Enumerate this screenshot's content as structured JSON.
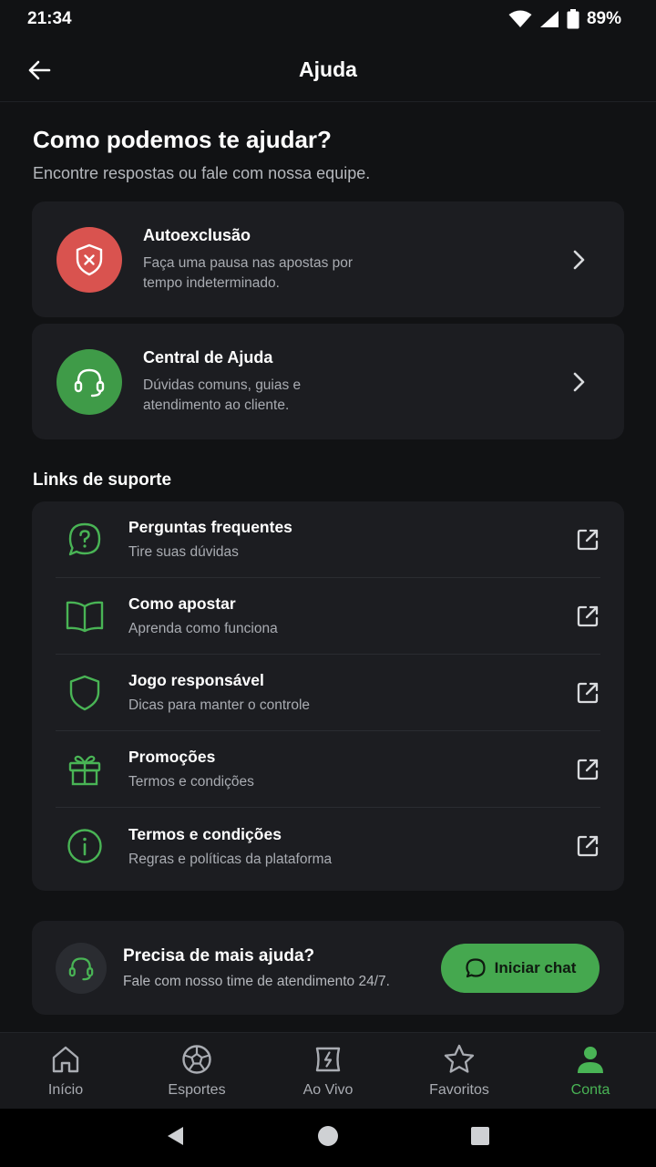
{
  "status": {
    "time": "21:34",
    "battery": "89%"
  },
  "header": {
    "title": "Ajuda"
  },
  "intro": {
    "title": "Como podemos te ajudar?",
    "subtitle": "Encontre respostas ou fale com nossa equipe."
  },
  "actions": [
    {
      "title": "Autoexclusão",
      "desc": "Faça uma pausa nas apostas por tempo indeterminado.",
      "icon": "shield-x-icon",
      "color": "#d9534f"
    },
    {
      "title": "Central de Ajuda",
      "desc": "Dúvidas comuns, guias e atendimento ao cliente.",
      "icon": "headset-icon",
      "color": "#3f9b48"
    }
  ],
  "support": {
    "title": "Links de suporte",
    "links": [
      {
        "title": "Perguntas frequentes",
        "desc": "Tire suas dúvidas",
        "icon": "question-bubble-icon"
      },
      {
        "title": "Como apostar",
        "desc": "Aprenda como funciona",
        "icon": "book-icon"
      },
      {
        "title": "Jogo responsável",
        "desc": "Dicas para manter o controle",
        "icon": "shield-icon"
      },
      {
        "title": "Promoções",
        "desc": "Termos e condições",
        "icon": "gift-icon"
      },
      {
        "title": "Termos e condições",
        "desc": "Regras e políticas da plataforma",
        "icon": "info-icon"
      }
    ]
  },
  "help": {
    "title": "Precisa de mais ajuda?",
    "desc": "Fale com nosso time de atendimento 24/7.",
    "button": "Iniciar chat"
  },
  "nav": {
    "items": [
      {
        "label": "Início",
        "icon": "home-icon"
      },
      {
        "label": "Esportes",
        "icon": "soccer-ball-icon"
      },
      {
        "label": "Ao Vivo",
        "icon": "live-icon"
      },
      {
        "label": "Favoritos",
        "icon": "star-icon"
      },
      {
        "label": "Conta",
        "icon": "user-icon"
      }
    ],
    "active": "Conta"
  },
  "colors": {
    "accent": "#49b455",
    "danger": "#d9534f",
    "background": "#111214",
    "card": "#1c1d21"
  }
}
